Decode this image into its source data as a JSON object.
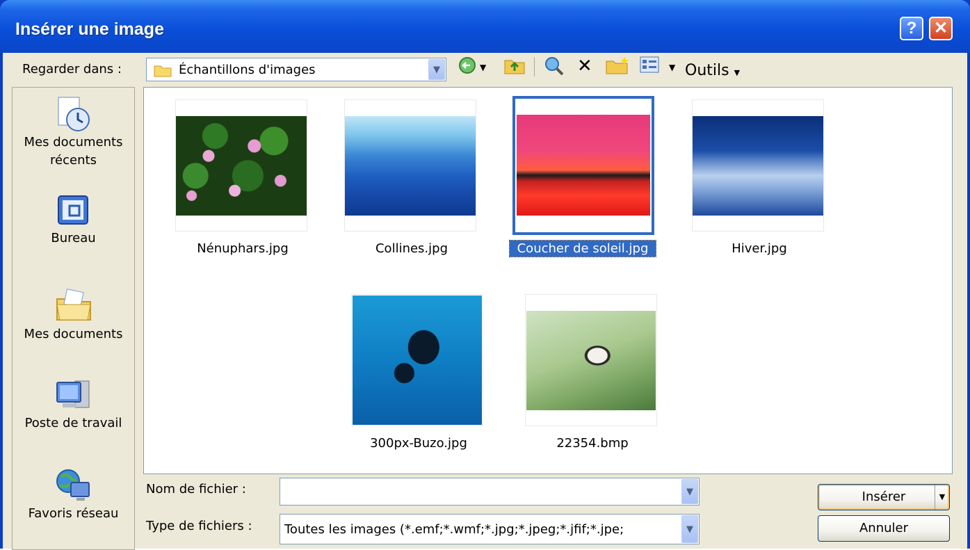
{
  "window": {
    "title": "Insérer une image",
    "help_glyph": "?",
    "close_glyph": "✕"
  },
  "toolbar": {
    "look_in_label": "Regarder dans :",
    "look_in_value": "Échantillons d'images",
    "tools_label": "Outils",
    "icons": [
      "back-icon",
      "up-folder-icon",
      "search-web-icon",
      "delete-icon",
      "new-folder-icon",
      "views-icon"
    ]
  },
  "places": [
    {
      "label_line1": "Mes documents",
      "label_line2": "récents",
      "icon": "recent-documents-icon"
    },
    {
      "label_line1": "Bureau",
      "label_line2": "",
      "icon": "desktop-icon"
    },
    {
      "label_line1": "Mes documents",
      "label_line2": "",
      "icon": "my-documents-icon"
    },
    {
      "label_line1": "Poste de travail",
      "label_line2": "",
      "icon": "my-computer-icon"
    },
    {
      "label_line1": "Favoris réseau",
      "label_line2": "",
      "icon": "network-places-icon"
    }
  ],
  "files": [
    {
      "name": "Nénuphars.jpg",
      "selected": false
    },
    {
      "name": "Collines.jpg",
      "selected": false
    },
    {
      "name": "Coucher de soleil.jpg",
      "selected": true
    },
    {
      "name": "Hiver.jpg",
      "selected": false
    },
    {
      "name": "300px-Buzo.jpg",
      "selected": false
    },
    {
      "name": "22354.bmp",
      "selected": false
    }
  ],
  "form": {
    "filename_label": "Nom de fichier :",
    "filename_value": "",
    "filetype_label": "Type de fichiers :",
    "filetype_value": "Toutes les images (*.emf;*.wmf;*.jpg;*.jpeg;*.jfif;*.jpe;"
  },
  "buttons": {
    "insert_label": "Insérer",
    "cancel_label": "Annuler"
  },
  "colors": {
    "title_blue": "#0a4fd9",
    "selection_blue": "#316ac5",
    "dialog_face": "#ece9d8"
  }
}
